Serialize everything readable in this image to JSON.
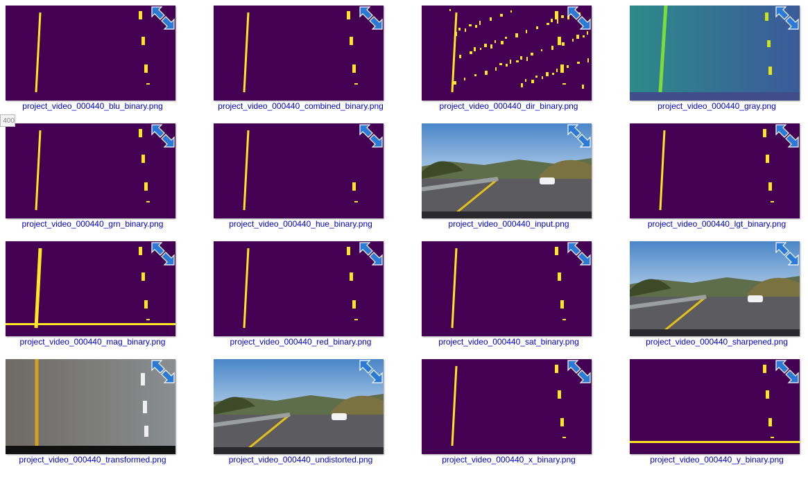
{
  "edge_tag": "400",
  "colors": {
    "binary_bg": "#440154",
    "binary_fg": "#fde725",
    "label": "#0000cc",
    "pin": "#2a7ad6"
  },
  "files": [
    {
      "name": "project_video_000440_blu_binary.png",
      "kind": "binary"
    },
    {
      "name": "project_video_000440_combined_binary.png",
      "kind": "binary"
    },
    {
      "name": "project_video_000440_dir_binary.png",
      "kind": "binary"
    },
    {
      "name": "project_video_000440_gray.png",
      "kind": "gray"
    },
    {
      "name": "project_video_000440_grn_binary.png",
      "kind": "binary"
    },
    {
      "name": "project_video_000440_hue_binary.png",
      "kind": "binary"
    },
    {
      "name": "project_video_000440_input.png",
      "kind": "photo"
    },
    {
      "name": "project_video_000440_lgt_binary.png",
      "kind": "binary"
    },
    {
      "name": "project_video_000440_mag_binary.png",
      "kind": "binary"
    },
    {
      "name": "project_video_000440_red_binary.png",
      "kind": "binary"
    },
    {
      "name": "project_video_000440_sat_binary.png",
      "kind": "binary"
    },
    {
      "name": "project_video_000440_sharpened.png",
      "kind": "photo"
    },
    {
      "name": "project_video_000440_transformed.png",
      "kind": "transformed"
    },
    {
      "name": "project_video_000440_undistorted.png",
      "kind": "photo"
    },
    {
      "name": "project_video_000440_x_binary.png",
      "kind": "binary"
    },
    {
      "name": "project_video_000440_y_binary.png",
      "kind": "binary"
    }
  ]
}
